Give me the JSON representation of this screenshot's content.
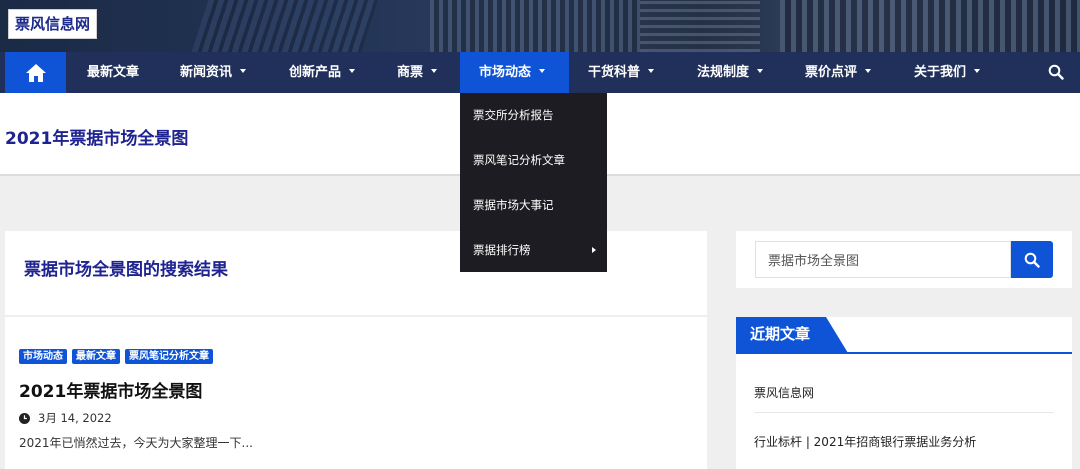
{
  "site": {
    "logo": "票风信息网"
  },
  "nav": {
    "items": [
      {
        "label": "最新文章",
        "has_caret": false
      },
      {
        "label": "新闻资讯",
        "has_caret": true
      },
      {
        "label": "创新产品",
        "has_caret": true
      },
      {
        "label": "商票",
        "has_caret": true
      },
      {
        "label": "市场动态",
        "has_caret": true,
        "active": true
      },
      {
        "label": "干货科普",
        "has_caret": true
      },
      {
        "label": "法规制度",
        "has_caret": true
      },
      {
        "label": "票价点评",
        "has_caret": true
      },
      {
        "label": "关于我们",
        "has_caret": true
      }
    ],
    "dropdown": [
      {
        "label": "票交所分析报告"
      },
      {
        "label": "票风笔记分析文章"
      },
      {
        "label": "票据市场大事记"
      },
      {
        "label": "票据排行榜",
        "has_submenu": true
      }
    ]
  },
  "page": {
    "title": "2021年票据市场全景图"
  },
  "results": {
    "heading": "票据市场全景图的搜索结果"
  },
  "post": {
    "tags": [
      "市场动态",
      "最新文章",
      "票风笔记分析文章"
    ],
    "title": "2021年票据市场全景图",
    "date": "3月 14, 2022",
    "excerpt": "2021年已悄然过去，今天为大家整理一下..."
  },
  "sidebar": {
    "search_value": "票据市场全景图",
    "recent_title": "近期文章",
    "recent": [
      "票风信息网",
      "行业标杆 | 2021年招商银行票据业务分析"
    ]
  },
  "colors": {
    "accent": "#0f54d6",
    "nav_bg": "#20305a",
    "title_color": "#1f2390",
    "dropdown_bg": "#1c1c22"
  }
}
